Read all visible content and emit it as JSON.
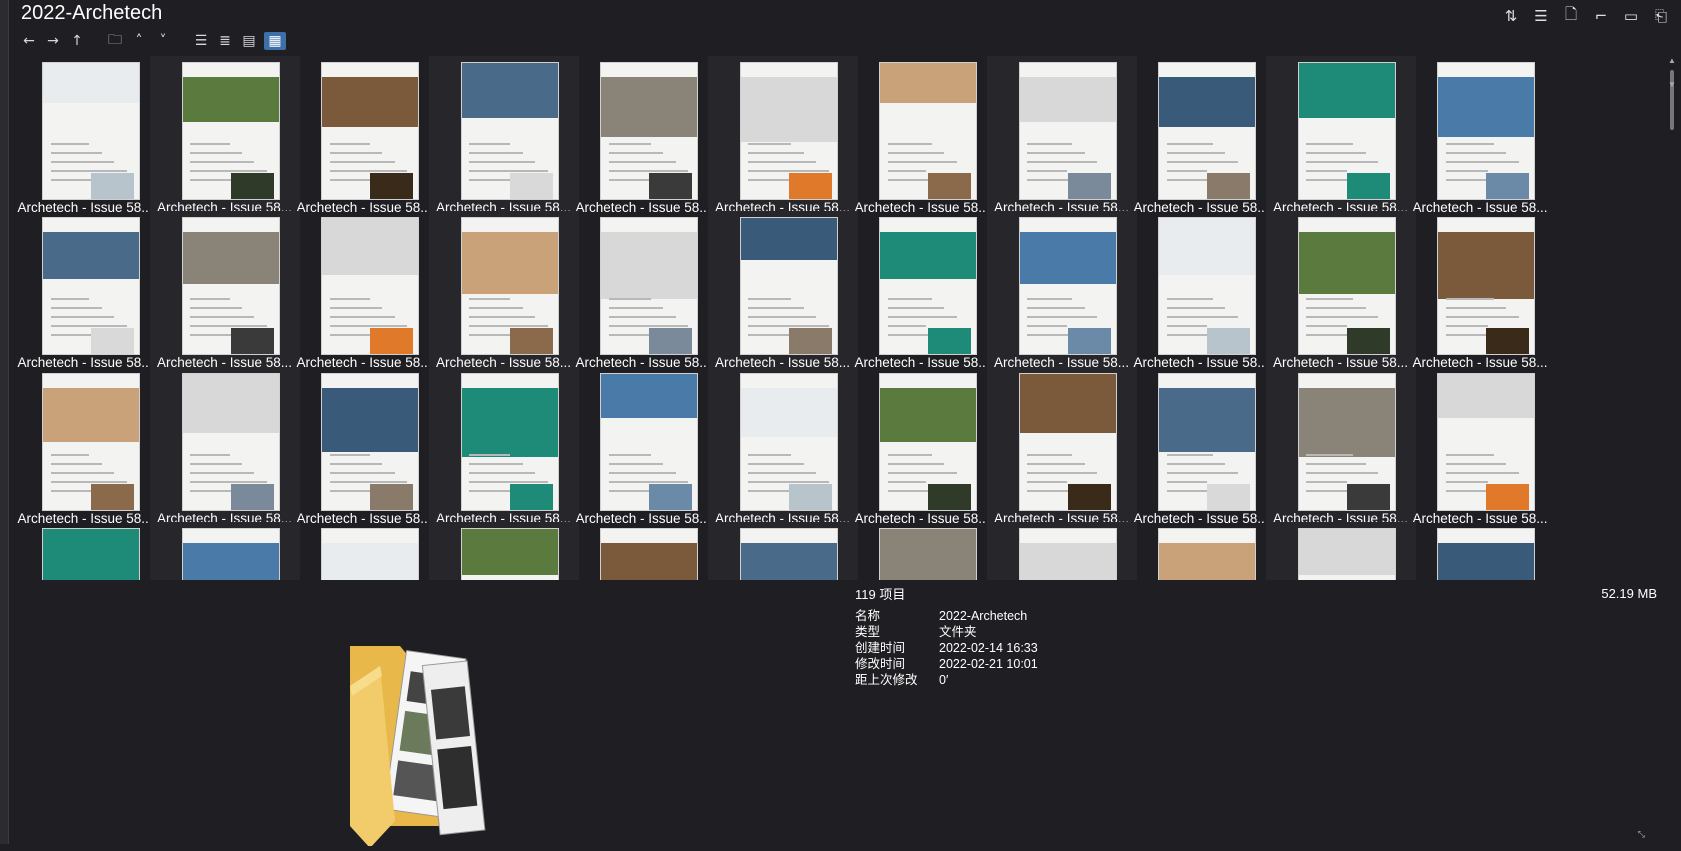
{
  "window": {
    "title": "2022-Archetech"
  },
  "top_icons": [
    {
      "name": "sort-icon",
      "glyph": "⇅"
    },
    {
      "name": "details-view-icon",
      "glyph": "☰"
    },
    {
      "name": "document-icon",
      "glyph": "🗋"
    },
    {
      "name": "crop-icon",
      "glyph": "⌐"
    },
    {
      "name": "panel-icon",
      "glyph": "▭"
    },
    {
      "name": "pin-icon",
      "glyph": "⎗"
    }
  ],
  "toolbar": [
    {
      "name": "back-icon",
      "glyph": "←"
    },
    {
      "name": "forward-icon",
      "glyph": "→"
    },
    {
      "name": "up-icon",
      "glyph": "↑"
    },
    {
      "name": "folder-icon",
      "glyph": "🗀"
    },
    {
      "name": "caret-up-icon",
      "glyph": "˄"
    },
    {
      "name": "caret-down-icon",
      "glyph": "˅"
    },
    {
      "name": "list-view-icon",
      "glyph": "☰"
    },
    {
      "name": "detail-view-icon",
      "glyph": "≣"
    },
    {
      "name": "tile-view-icon",
      "glyph": "▤"
    },
    {
      "name": "thumbnail-view-icon",
      "glyph": "▦",
      "selected": true
    }
  ],
  "items": {
    "caption": "Archetech - Issue 58...",
    "row_count": 4,
    "col_count": 11
  },
  "info": {
    "count": "119 项目",
    "size": "52.19 MB",
    "props": [
      {
        "k": "名称",
        "v": "2022-Archetech"
      },
      {
        "k": "类型",
        "v": "文件夹"
      },
      {
        "k": "创建时间",
        "v": "2022-02-14  16:33"
      },
      {
        "k": "修改时间",
        "v": "2022-02-21  10:01"
      },
      {
        "k": "距上次修改",
        "v": "0′"
      }
    ]
  },
  "colors": {
    "selected": "#3d6fa8",
    "background": "#1f1f23",
    "alt_cell": "#26262b"
  }
}
